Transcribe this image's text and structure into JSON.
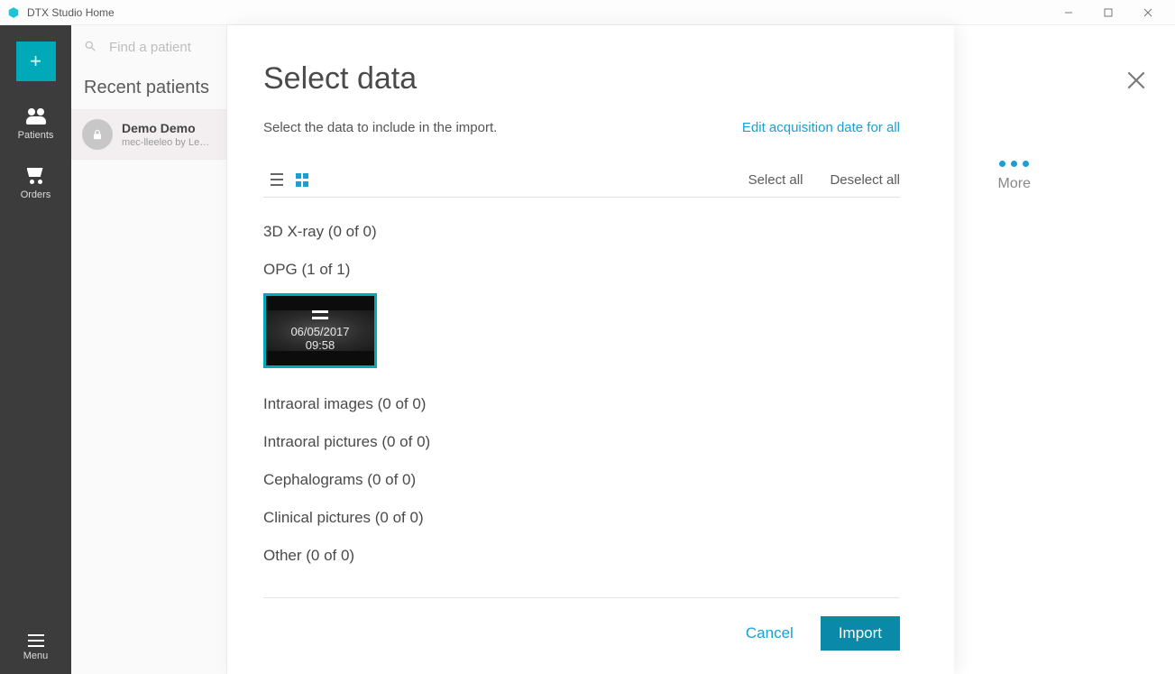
{
  "window": {
    "title": "DTX Studio Home"
  },
  "sidebar": {
    "patients_label": "Patients",
    "orders_label": "Orders",
    "menu_label": "Menu"
  },
  "search": {
    "placeholder": "Find a patient"
  },
  "recent": {
    "header": "Recent patients",
    "items": [
      {
        "name": "Demo Demo",
        "sub": "mec-lleeleo by Lee.Le"
      }
    ]
  },
  "right": {
    "more_label": "More"
  },
  "modal": {
    "title": "Select data",
    "description": "Select the data to include in the import.",
    "edit_link": "Edit acquisition date for all",
    "select_all": "Select all",
    "deselect_all": "Deselect all",
    "categories": {
      "xray3d": "3D X-ray (0 of 0)",
      "opg": "OPG (1 of 1)",
      "intraoral_images": "Intraoral images (0 of 0)",
      "intraoral_pictures": "Intraoral pictures (0 of 0)",
      "cephalograms": "Cephalograms (0 of 0)",
      "clinical_pictures": "Clinical pictures (0 of 0)",
      "other": "Other (0 of 0)"
    },
    "opg_item": {
      "date": "06/05/2017",
      "time": "09:58"
    },
    "cancel": "Cancel",
    "import": "Import"
  },
  "colors": {
    "accent": "#00a9b7",
    "link": "#1a9fd4"
  }
}
